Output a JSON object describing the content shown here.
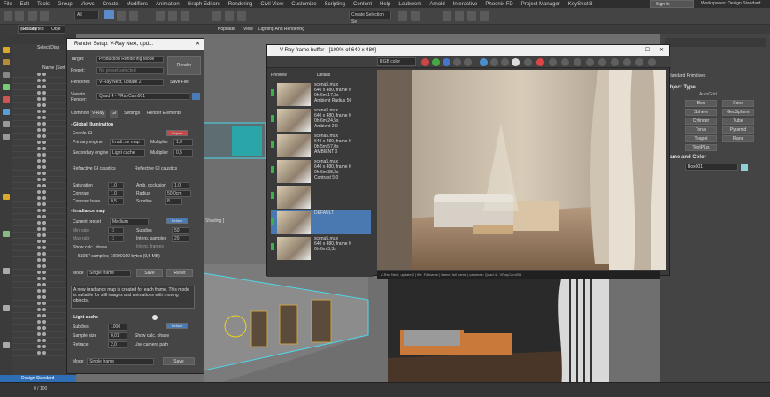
{
  "menu": [
    "File",
    "Edit",
    "Tools",
    "Group",
    "Views",
    "Create",
    "Modifiers",
    "Animation",
    "Graph Editors",
    "Rendering",
    "Civil View",
    "Customize",
    "Scripting",
    "Content",
    "Help",
    "Laubwerk",
    "Arnold",
    "Interactive",
    "Phoenix FD",
    "Project Manager",
    "KeyShot 8"
  ],
  "signin": "Sign In",
  "workspaces_label": "Workspaces:",
  "workspace": "Design Standard",
  "toolbar": {
    "filter": "All",
    "create_selection": "Create Selection Se",
    "layer": "(default)"
  },
  "toolbar2": [
    "Get Started",
    "Obje",
    "",
    "",
    "",
    "",
    "",
    "Populate",
    "View",
    "Lighting And Rendering"
  ],
  "scene": {
    "tabs": [
      "Select",
      "Disp"
    ],
    "header": "Name (Sort"
  },
  "render_setup": {
    "title": "Render Setup: V-Ray Next, upd...",
    "target_label": "Target:",
    "target": "Production Rendering Mode",
    "preset_label": "Preset:",
    "preset": "No preset selected",
    "renderer_label": "Renderer:",
    "renderer": "V-Ray Next, update 2",
    "save_file": "Save File",
    "view_label": "View to Render:",
    "view": "Quad 4 - VRayCam001",
    "render_btn": "Render",
    "tabs": [
      "Common",
      "V-Ray",
      "GI",
      "Settings",
      "Render Elements"
    ],
    "gi_title": "Global illumination",
    "expert": "Expert",
    "enable_gi": "Enable GI",
    "primary_label": "Primary engine",
    "primary": "Irradi..ce map",
    "secondary_label": "Secondary engine",
    "secondary": "Light cache",
    "multiplier_label": "Multiplier",
    "mult1": "1,0",
    "mult2": "0,5",
    "refractive": "Refractive GI caustics",
    "reflective": "Reflective GI caustics",
    "saturation_label": "Saturation",
    "saturation": "1,0",
    "contrast_label": "Contrast",
    "contrast": "1,0",
    "contrast_base_label": "Contrast base",
    "contrast_base": "0,5",
    "amb_occ": "Amb. occlusion",
    "amb_val": "1,0",
    "radius_label": "Radius",
    "radius": "50,0cm",
    "subdivs_label": "Subdivs",
    "subdivs": "8",
    "irr_title": "Irradiance map",
    "default_btn": "Default",
    "current_preset_label": "Current preset",
    "current_preset": "Medium",
    "min_rate_label": "Min rate",
    "min_rate": "-3",
    "max_rate_label": "Max rate",
    "max_rate": "-1",
    "subdivs2_label": "Subdivs",
    "subdivs2": "50",
    "interp_label": "Interp. samples",
    "interp": "20",
    "interp_frames_label": "Interp. frames",
    "show_calc": "Show calc. phase",
    "samples_info": "51057 samples; 10000160 bytes (9,5 MB)",
    "mode_label": "Mode",
    "mode": "Single frame",
    "save_btn": "Save",
    "reset_btn": "Reset",
    "desc": "A new irradiance map is created for each frame. This mode is suitable for still images and animations with moving objects.",
    "lc_title": "Light cache",
    "lc_subdivs_label": "Subdivs",
    "lc_subdivs": "1000",
    "sample_size_label": "Sample size",
    "sample_size": "0,01",
    "lc_show_calc": "Show calc. phase",
    "retrace_label": "Retrace",
    "retrace": "2,0",
    "use_camera": "Use camera path",
    "mode2_label": "Mode",
    "mode2": "Single frame",
    "save2_btn": "Save"
  },
  "fb": {
    "title": "V-Ray frame buffer - [100% of 640 x 480]",
    "channel": "RGB color",
    "history_tab": "Preview",
    "details_tab": "Details",
    "history": [
      "scena5.max\n640 x 480, frame 0\n0h 6m 17,3s\nAmbient Radius 50",
      "scena5.max\n640 x 480, frame 0\n0h 6m 24,5s\nAmbient 2.0",
      "scena5.max\n640 x 480, frame 0\n0h 5m 57,0s\nAMBIENT 0",
      "scena5.max\n640 x 480, frame 0\n0h 6m 38,3s\nContrast 5.0",
      "",
      "DEFAULT",
      "scena5.max\n640 x 480, frame 0\n0h 6m 3,3s"
    ]
  },
  "status": "V-Ray Next, update 2 | file: Fullname | frame: full name | cameras: Quad 4 - VRayCam001",
  "shading": "Shading ]",
  "right_panel": {
    "section": "Standard Primitives",
    "object_type": "Object Type",
    "autogrid": "AutoGrid",
    "buttons": [
      "Box",
      "Cone",
      "Sphere",
      "GeoSphere",
      "Cylinder",
      "Tube",
      "Torus",
      "Pyramid",
      "Teapot",
      "Plane",
      "TextPlus"
    ],
    "name_color": "Name and Color",
    "object_name": "Box001"
  },
  "bottom": {
    "workspace": "Design Standard",
    "time": "0 / 100"
  }
}
